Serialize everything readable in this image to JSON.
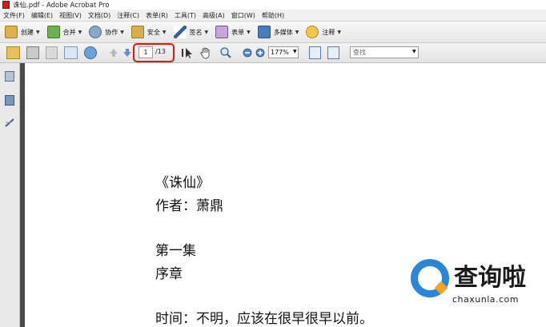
{
  "window": {
    "title": "诛仙.pdf - Adobe Acrobat Pro"
  },
  "menubar": {
    "items": [
      "文件(F)",
      "编辑(E)",
      "视图(V)",
      "文档(D)",
      "注释(C)",
      "表单(R)",
      "工具(T)",
      "高级(A)",
      "窗口(W)",
      "帮助(H)"
    ]
  },
  "tasks": {
    "create": "创建",
    "combine": "合并",
    "collaborate": "协作",
    "secure": "安全",
    "sign": "签名",
    "forms": "表单",
    "multimedia": "多媒体",
    "comment": "注释"
  },
  "toolbar": {
    "page_current": "1",
    "page_total": "/13",
    "zoom": "177%",
    "search_placeholder": "查找"
  },
  "document": {
    "lines": [
      "《诛仙》",
      "作者：萧鼎",
      "第一集",
      "序章",
      "时间：不明，应该在很早很早以前。"
    ]
  },
  "watermark": {
    "brand_cn": "查询啦",
    "url": "chaxunla.com"
  },
  "colors": {
    "highlight": "#e01515",
    "wm_blue": "#2a86d6",
    "wm_orange": "#f5a21d"
  }
}
